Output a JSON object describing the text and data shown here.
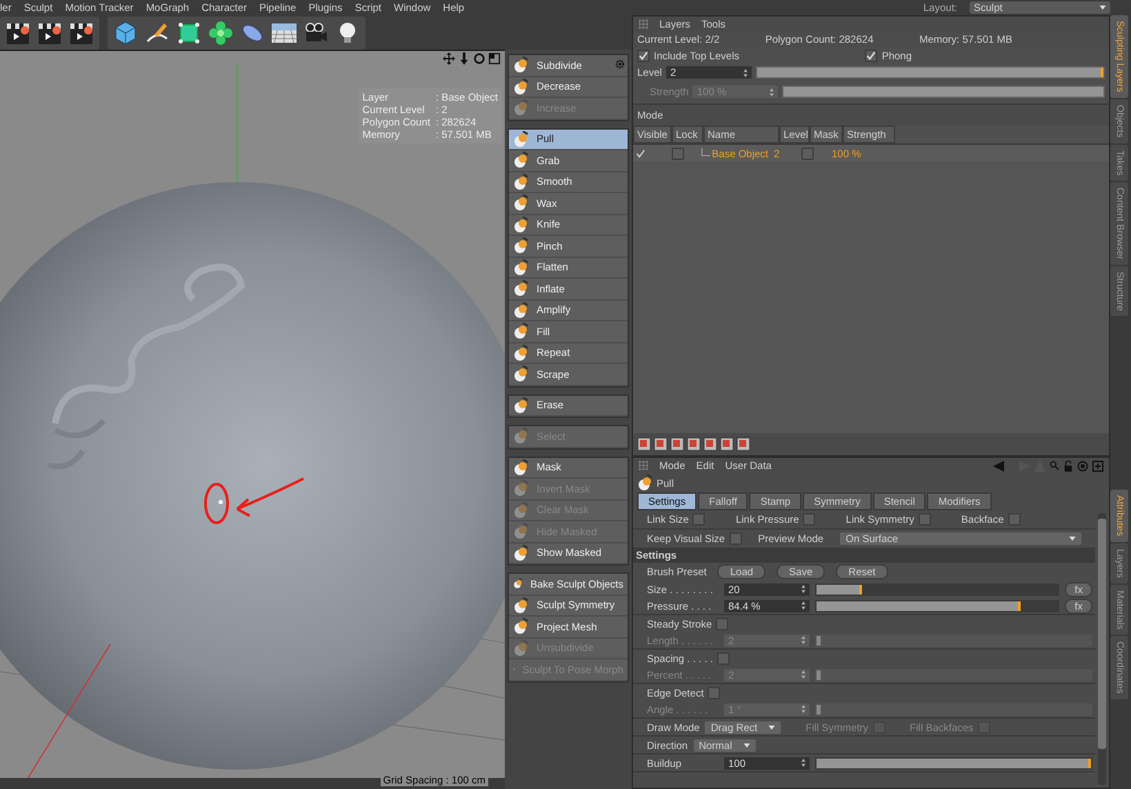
{
  "menu_bar": {
    "items": [
      "ler",
      "Sculpt",
      "Motion Tracker",
      "MoGraph",
      "Character",
      "Pipeline",
      "Plugins",
      "Script",
      "Window",
      "Help"
    ],
    "layout_label": "Layout:",
    "layout_value": "Sculpt"
  },
  "viewport": {
    "info": [
      {
        "label": "Layer",
        "value": ": Base Object"
      },
      {
        "label": "Current Level",
        "value": ": 2"
      },
      {
        "label": "Polygon Count",
        "value": ": 282624"
      },
      {
        "label": "Memory",
        "value": ": 57.501 MB"
      }
    ],
    "grid_spacing": "Grid Spacing : 100 cm"
  },
  "tool_groups": [
    {
      "items": [
        {
          "label": "Subdivide",
          "selected": false,
          "disabled": false
        },
        {
          "label": "Decrease",
          "selected": false,
          "disabled": false
        },
        {
          "label": "Increase",
          "selected": false,
          "disabled": true
        }
      ]
    },
    {
      "items": [
        {
          "label": "Pull",
          "selected": true,
          "disabled": false
        },
        {
          "label": "Grab",
          "selected": false,
          "disabled": false
        },
        {
          "label": "Smooth",
          "selected": false,
          "disabled": false
        },
        {
          "label": "Wax",
          "selected": false,
          "disabled": false
        },
        {
          "label": "Knife",
          "selected": false,
          "disabled": false
        },
        {
          "label": "Pinch",
          "selected": false,
          "disabled": false
        },
        {
          "label": "Flatten",
          "selected": false,
          "disabled": false
        },
        {
          "label": "Inflate",
          "selected": false,
          "disabled": false
        },
        {
          "label": "Amplify",
          "selected": false,
          "disabled": false
        },
        {
          "label": "Fill",
          "selected": false,
          "disabled": false
        },
        {
          "label": "Repeat",
          "selected": false,
          "disabled": false
        },
        {
          "label": "Scrape",
          "selected": false,
          "disabled": false
        }
      ]
    },
    {
      "items": [
        {
          "label": "Erase",
          "selected": false,
          "disabled": false
        }
      ]
    },
    {
      "items": [
        {
          "label": "Select",
          "selected": false,
          "disabled": true
        }
      ]
    },
    {
      "items": [
        {
          "label": "Mask",
          "selected": false,
          "disabled": false
        },
        {
          "label": "Invert Mask",
          "selected": false,
          "disabled": true
        },
        {
          "label": "Clear Mask",
          "selected": false,
          "disabled": true
        },
        {
          "label": "Hide Masked",
          "selected": false,
          "disabled": true
        },
        {
          "label": "Show Masked",
          "selected": false,
          "disabled": false
        }
      ]
    },
    {
      "items": [
        {
          "label": "Bake Sculpt Objects",
          "selected": false,
          "disabled": false
        },
        {
          "label": "Sculpt Symmetry",
          "selected": false,
          "disabled": false
        },
        {
          "label": "Project Mesh",
          "selected": false,
          "disabled": false
        },
        {
          "label": "Unsubdivide",
          "selected": false,
          "disabled": true
        },
        {
          "label": "Sculpt To Pose Morph",
          "selected": false,
          "disabled": true
        }
      ]
    }
  ],
  "layers_panel": {
    "menu": [
      "Layers",
      "Tools"
    ],
    "current_level": "Current Level: 2/2",
    "polygon_count": "Polygon Count: 282624",
    "memory": "Memory: 57.501 MB",
    "include_top_levels": {
      "label": "Include Top Levels",
      "checked": true
    },
    "phong": {
      "label": "Phong",
      "checked": true
    },
    "level": {
      "label": "Level",
      "value": "2",
      "level": 1.0
    },
    "strength": {
      "label": "Strength",
      "value": "100 %",
      "level": 1.0
    },
    "mode_label": "Mode",
    "columns": [
      "Visible",
      "Lock",
      "Name",
      "Level",
      "Mask",
      "Strength"
    ],
    "rows": [
      {
        "visible": true,
        "lock": false,
        "name": "Base Object",
        "level": "2",
        "mask": false,
        "strength": "100 %"
      }
    ]
  },
  "attributes": {
    "menu": [
      "Mode",
      "Edit",
      "User Data"
    ],
    "tool_name": "Pull",
    "tabs": [
      {
        "label": "Settings",
        "selected": true
      },
      {
        "label": "Falloff",
        "selected": false
      },
      {
        "label": "Stamp",
        "selected": false
      },
      {
        "label": "Symmetry",
        "selected": false
      },
      {
        "label": "Stencil",
        "selected": false
      },
      {
        "label": "Modifiers",
        "selected": false
      }
    ],
    "links": [
      {
        "label": "Link Size",
        "checked": false
      },
      {
        "label": "Link Pressure",
        "checked": false
      },
      {
        "label": "Link Symmetry",
        "checked": false
      },
      {
        "label": "Backface",
        "checked": false
      }
    ],
    "keep_visual_size": {
      "label": "Keep Visual Size",
      "checked": false
    },
    "preview_mode": {
      "label": "Preview Mode",
      "value": "On Surface"
    },
    "section": "Settings",
    "brush_preset": {
      "label": "Brush Preset",
      "buttons": [
        "Load",
        "Save",
        "Reset"
      ]
    },
    "groups": [
      {
        "rows": [
          {
            "kind": "slider",
            "label": "Size . . . . . . . .",
            "value": "20",
            "level": 0.19,
            "fx": "fx",
            "disabled": false
          },
          {
            "kind": "slider",
            "label": "Pressure . . . .",
            "value": "84.4 %",
            "level": 0.844,
            "fx": "fx",
            "disabled": false
          }
        ]
      },
      {
        "rows": [
          {
            "kind": "checkbox",
            "label": "Steady Stroke",
            "checked": false,
            "disabled": false
          },
          {
            "kind": "slider",
            "label": "Length . . . . . .",
            "value": "2",
            "level": 0.01,
            "disabled": true
          }
        ]
      },
      {
        "rows": [
          {
            "kind": "checkbox",
            "label": "Spacing . . . . .",
            "checked": false,
            "disabled": false
          },
          {
            "kind": "slider",
            "label": "Percent . . . . .",
            "value": "2",
            "level": 0.01,
            "disabled": true
          }
        ]
      },
      {
        "rows": [
          {
            "kind": "checkbox",
            "label": "Edge Detect",
            "checked": false,
            "disabled": false
          },
          {
            "kind": "slider",
            "label": "Angle . . . . . .",
            "value": "1 °",
            "level": 0.0,
            "disabled": true
          }
        ]
      },
      {
        "rows": [
          {
            "kind": "dropdown",
            "label": "Draw Mode",
            "value": "Drag Rect",
            "checks": [
              {
                "label": "Fill Symmetry",
                "checked": false
              },
              {
                "label": "Fill Backfaces",
                "checked": false
              }
            ]
          }
        ]
      },
      {
        "rows": [
          {
            "kind": "dropdown",
            "label": "Direction",
            "value": "Normal"
          }
        ]
      },
      {
        "rows": [
          {
            "kind": "slider",
            "label": "Buildup",
            "value": "100",
            "level": 1.0,
            "disabled": false
          }
        ]
      }
    ]
  },
  "side_tabs_top": [
    {
      "label": "Sculpting Layers",
      "selected": true
    },
    {
      "label": "Objects",
      "selected": false
    },
    {
      "label": "Takes",
      "selected": false
    },
    {
      "label": "Content Browser",
      "selected": false
    },
    {
      "label": "Structure",
      "selected": false
    }
  ],
  "side_tabs_bottom": [
    {
      "label": "Attributes",
      "selected": true
    },
    {
      "label": "Layers",
      "selected": false
    },
    {
      "label": "Materials",
      "selected": false
    },
    {
      "label": "Coordinates",
      "selected": false
    }
  ]
}
